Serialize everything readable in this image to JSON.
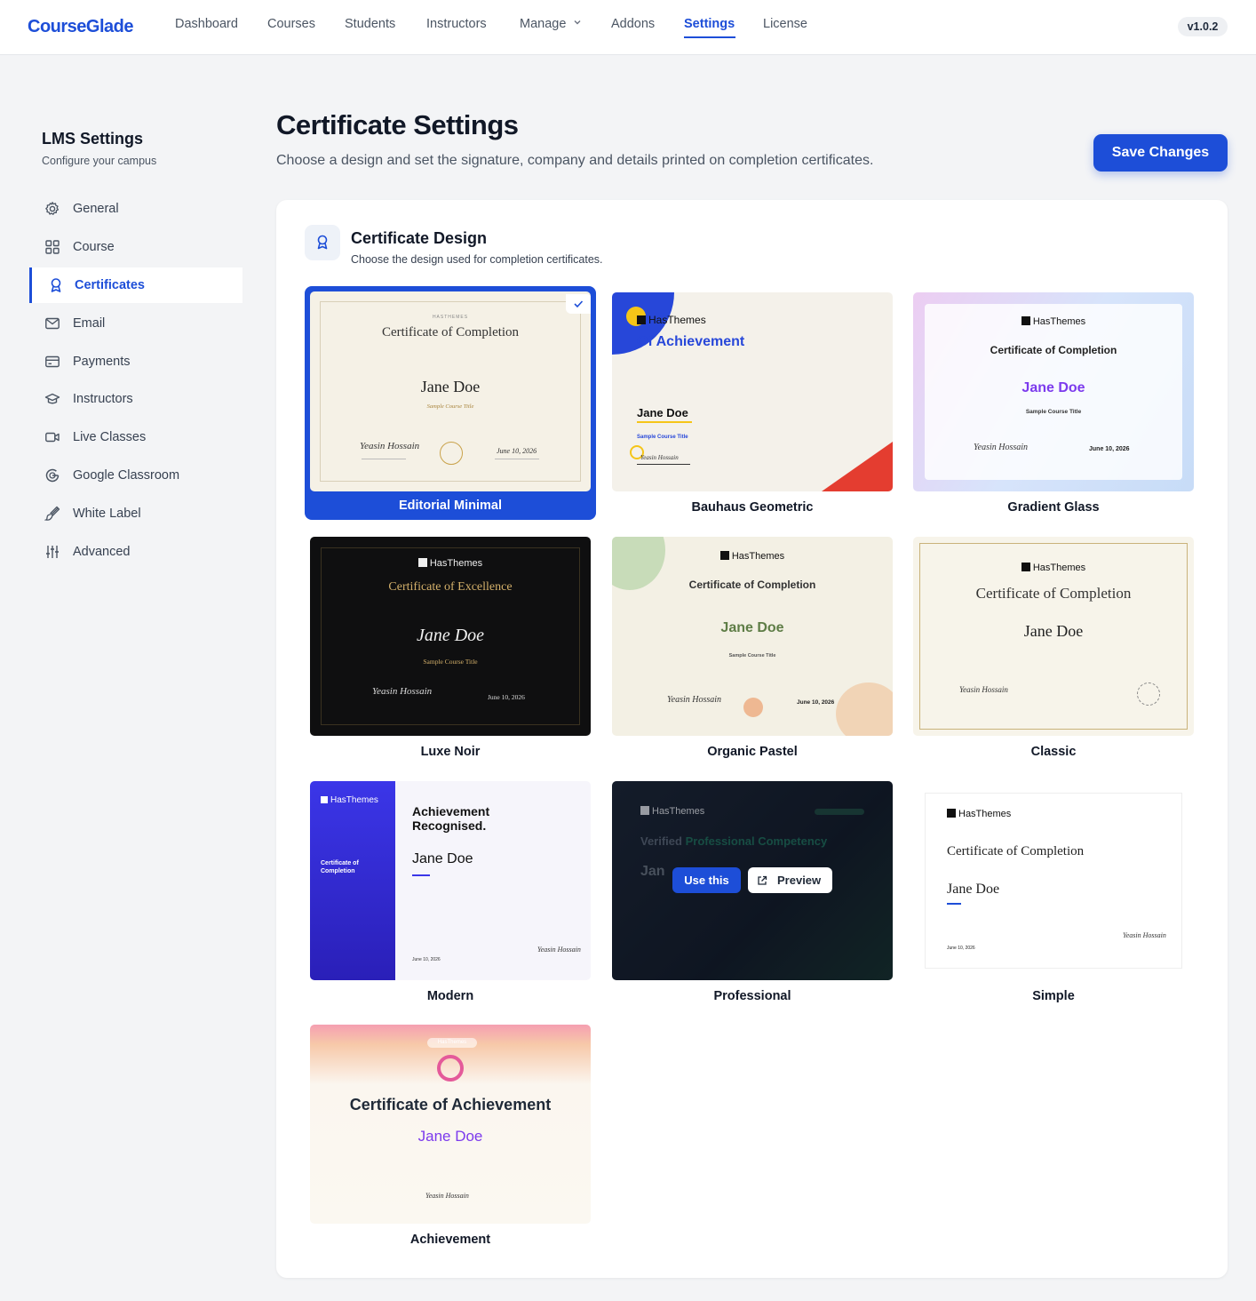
{
  "nav": {
    "brand": "CourseGlade",
    "items": [
      "Dashboard",
      "Courses",
      "Students",
      "Instructors",
      "Manage",
      "Addons",
      "Settings",
      "License"
    ],
    "active": "Settings",
    "version": "v1.0.2"
  },
  "sidebar": {
    "title": "LMS Settings",
    "subtitle": "Configure your campus",
    "items": [
      {
        "label": "General",
        "icon": "gear-icon"
      },
      {
        "label": "Course",
        "icon": "grid-icon"
      },
      {
        "label": "Certificates",
        "icon": "award-icon"
      },
      {
        "label": "Email",
        "icon": "mail-icon"
      },
      {
        "label": "Payments",
        "icon": "credit-card-icon"
      },
      {
        "label": "Instructors",
        "icon": "graduation-cap-icon"
      },
      {
        "label": "Live Classes",
        "icon": "video-icon"
      },
      {
        "label": "Google Classroom",
        "icon": "google-icon"
      },
      {
        "label": "White Label",
        "icon": "brush-icon"
      },
      {
        "label": "Advanced",
        "icon": "sliders-icon"
      }
    ],
    "active": "Certificates"
  },
  "header": {
    "title": "Certificate Settings",
    "description": "Choose a design and set the signature, company and details printed on completion certificates.",
    "save_label": "Save Changes"
  },
  "section": {
    "title": "Certificate Design",
    "subtitle": "Choose the design used for completion certificates."
  },
  "designs": [
    "Editorial Minimal",
    "Bauhaus Geometric",
    "Gradient Glass",
    "Luxe Noir",
    "Organic Pastel",
    "Classic",
    "Modern",
    "Professional",
    "Simple",
    "Achievement"
  ],
  "selected_design": "Editorial Minimal",
  "hover": {
    "use_label": "Use this",
    "preview_label": "Preview"
  },
  "samples": {
    "brand": "HasThemes",
    "brand_small": "HASTHEMES",
    "name": "Jane Doe",
    "course": "Sample Course Title",
    "date": "June 10, 2026",
    "date_script": "June 10, 2026",
    "signature": "Yeasin Hossain",
    "cert_completion": "Certificate of Completion",
    "cert_excellence": "Certificate of Excellence",
    "cert_achievement": "Certificate of Achievement",
    "of_achievement": "Of Achievement",
    "achievement_recognised": "Achievement Recognised.",
    "verified_prefix": "Verified",
    "verified_highlight": "Professional Competency",
    "modern_side": "Certificate of Completion",
    "jan": "Jan"
  },
  "colors": {
    "accent": "#1d4ed8",
    "purple": "#7c3aed",
    "gold": "#c9a24a",
    "red": "#e43d30"
  }
}
